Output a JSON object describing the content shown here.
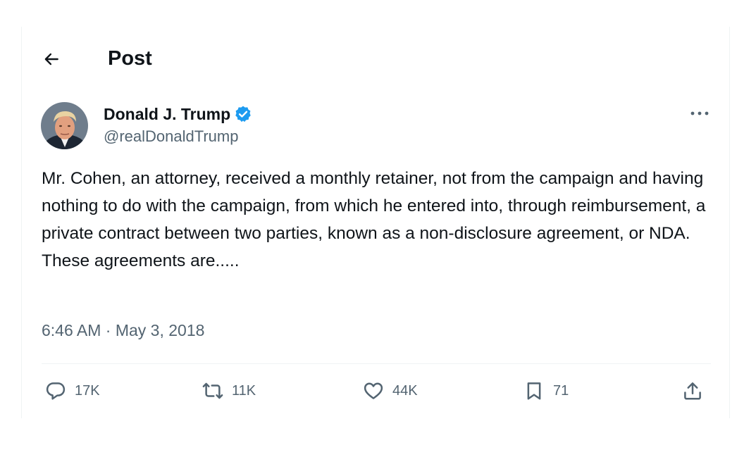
{
  "header": {
    "title": "Post"
  },
  "author": {
    "display_name": "Donald J. Trump",
    "handle": "@realDonaldTrump"
  },
  "post": {
    "text": "Mr. Cohen, an attorney, received a monthly retainer, not from the campaign and having nothing to do with the campaign, from which he entered into, through reimbursement, a private contract between two parties, known as a non-disclosure agreement, or NDA. These agreements are.....",
    "timestamp": "6:46 AM · May 3, 2018"
  },
  "actions": {
    "replies": "17K",
    "reposts": "11K",
    "likes": "44K",
    "bookmarks": "71"
  },
  "icons": {
    "back": "arrow-left-icon",
    "verified": "verified-badge-icon",
    "more": "more-horizontal-icon",
    "reply": "reply-icon",
    "repost": "repost-icon",
    "like": "heart-icon",
    "bookmark": "bookmark-icon",
    "share": "share-icon"
  },
  "colors": {
    "verified_badge": "#1d9bf0",
    "secondary_text": "#536471",
    "primary_text": "#0f1419"
  }
}
